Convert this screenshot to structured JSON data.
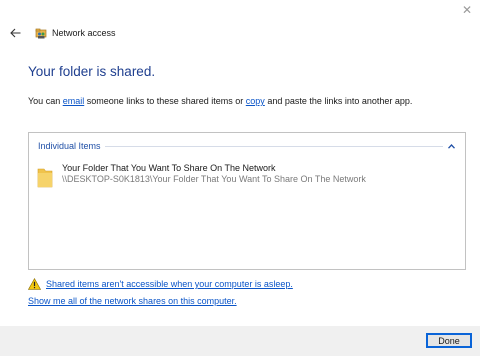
{
  "window": {
    "title": "Network access",
    "close_glyph": "✕"
  },
  "main": {
    "heading": "Your folder is shared.",
    "desc_prefix": "You can ",
    "desc_link1": "email",
    "desc_middle": " someone links to these shared items or ",
    "desc_link2": "copy",
    "desc_suffix": " and paste the links into another app."
  },
  "list": {
    "group_label": "Individual Items",
    "items": [
      {
        "name": "Your Folder That You Want To Share On The Network",
        "path": "\\\\DESKTOP-S0K1813\\Your Folder That You Want To Share On The Network",
        "icon": "folder-icon"
      }
    ]
  },
  "notices": {
    "warning_link": "Shared items aren't accessible when your computer is asleep.",
    "show_shares_link": "Show me all of the network shares on this computer."
  },
  "footer": {
    "done_label": "Done"
  },
  "colors": {
    "heading": "#1f3f8f",
    "link": "#0b55c8",
    "group_label": "#1f4fa6",
    "button_border": "#0a64d8",
    "warning": "#f2c811"
  }
}
